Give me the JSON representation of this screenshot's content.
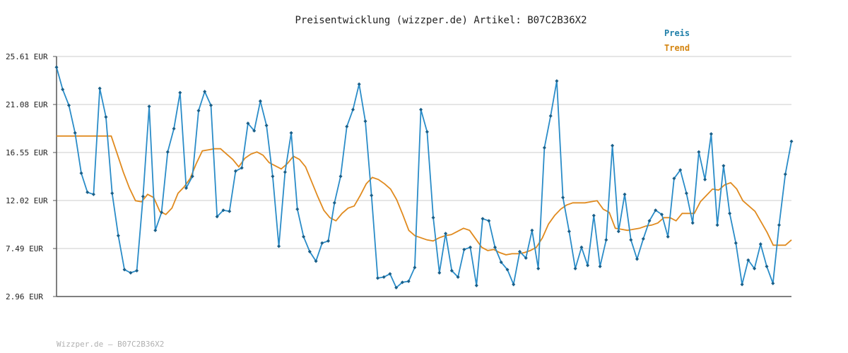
{
  "chart_data": {
    "type": "line",
    "title": "Preisentwicklung (wizzper.de) Artikel: B07C2B36X2",
    "footer": "Wizzper.de – B07C2B36X2",
    "ylim": [
      2.96,
      25.61
    ],
    "y_ticks": [
      "2.96 EUR",
      "7.49 EUR",
      "12.02 EUR",
      "16.55 EUR",
      "21.08 EUR",
      "25.61 EUR"
    ],
    "y_tick_values": [
      2.96,
      7.49,
      12.02,
      16.55,
      21.08,
      25.61
    ],
    "grid": true,
    "legend_position": "top-right",
    "colors": {
      "preis": "#2a8cc8",
      "trend": "#e08a1e",
      "axis": "#555555",
      "grid": "#dddddd"
    },
    "series": [
      {
        "name": "Preis",
        "values": [
          24.6,
          22.5,
          21.0,
          18.4,
          14.6,
          12.8,
          12.6,
          22.6,
          19.9,
          12.7,
          8.7,
          5.5,
          5.2,
          5.4,
          12.4,
          20.9,
          9.2,
          10.9,
          16.6,
          18.8,
          22.2,
          13.2,
          14.3,
          20.5,
          22.3,
          21.0,
          10.5,
          11.1,
          11.0,
          14.8,
          15.1,
          19.3,
          18.6,
          21.4,
          19.1,
          14.3,
          7.7,
          14.7,
          18.4,
          11.2,
          8.6,
          7.2,
          6.3,
          8.0,
          8.2,
          11.8,
          14.3,
          19.0,
          20.6,
          23.0,
          19.5,
          12.5,
          4.7,
          4.8,
          5.1,
          3.8,
          4.3,
          4.4,
          5.7,
          20.6,
          18.5,
          10.4,
          5.2,
          8.9,
          5.4,
          4.8,
          7.4,
          7.6,
          4.0,
          10.3,
          10.1,
          7.6,
          6.2,
          5.5,
          4.1,
          7.2,
          6.6,
          9.2,
          5.6,
          17.0,
          20.0,
          23.3,
          12.3,
          9.1,
          5.6,
          7.6,
          5.9,
          10.6,
          5.8,
          8.3,
          17.2,
          9.1,
          12.6,
          8.3,
          6.5,
          8.4,
          10.1,
          11.1,
          10.7,
          8.6,
          14.1,
          14.9,
          12.7,
          9.9,
          16.6,
          14.0,
          18.3,
          9.7,
          15.3,
          10.8,
          8.0,
          4.1,
          6.4,
          5.6,
          7.9,
          5.8,
          4.2,
          9.7,
          14.5,
          17.6
        ],
        "color": "#2a8cc8"
      },
      {
        "name": "Trend",
        "values": [
          18.1,
          18.1,
          18.1,
          18.1,
          18.1,
          18.1,
          18.1,
          18.1,
          18.1,
          18.1,
          16.4,
          14.7,
          13.2,
          12.0,
          11.9,
          12.6,
          12.3,
          11.0,
          10.7,
          11.3,
          12.7,
          13.3,
          14.1,
          15.5,
          16.7,
          16.8,
          16.9,
          16.9,
          16.4,
          15.9,
          15.2,
          16.0,
          16.4,
          16.6,
          16.3,
          15.6,
          15.3,
          15.0,
          15.5,
          16.2,
          15.9,
          15.2,
          13.8,
          12.4,
          11.1,
          10.4,
          10.1,
          10.8,
          11.3,
          11.5,
          12.5,
          13.6,
          14.2,
          14.0,
          13.6,
          13.1,
          12.1,
          10.7,
          9.2,
          8.7,
          8.5,
          8.3,
          8.2,
          8.5,
          8.7,
          8.8,
          9.1,
          9.4,
          9.2,
          8.4,
          7.6,
          7.3,
          7.4,
          7.1,
          6.9,
          7.0,
          7.0,
          7.1,
          7.3,
          7.6,
          8.5,
          9.8,
          10.6,
          11.2,
          11.6,
          11.8,
          11.8,
          11.8,
          11.9,
          12.0,
          11.2,
          10.9,
          9.4,
          9.3,
          9.2,
          9.3,
          9.4,
          9.6,
          9.7,
          9.9,
          10.4,
          10.4,
          10.1,
          10.8,
          10.8,
          10.8,
          11.9,
          12.5,
          13.1,
          13.0,
          13.5,
          13.7,
          13.1,
          12.0,
          11.5,
          11.0,
          10.0,
          9.0,
          7.8,
          7.8,
          7.8,
          8.3
        ],
        "color": "#e08a1e"
      }
    ]
  }
}
